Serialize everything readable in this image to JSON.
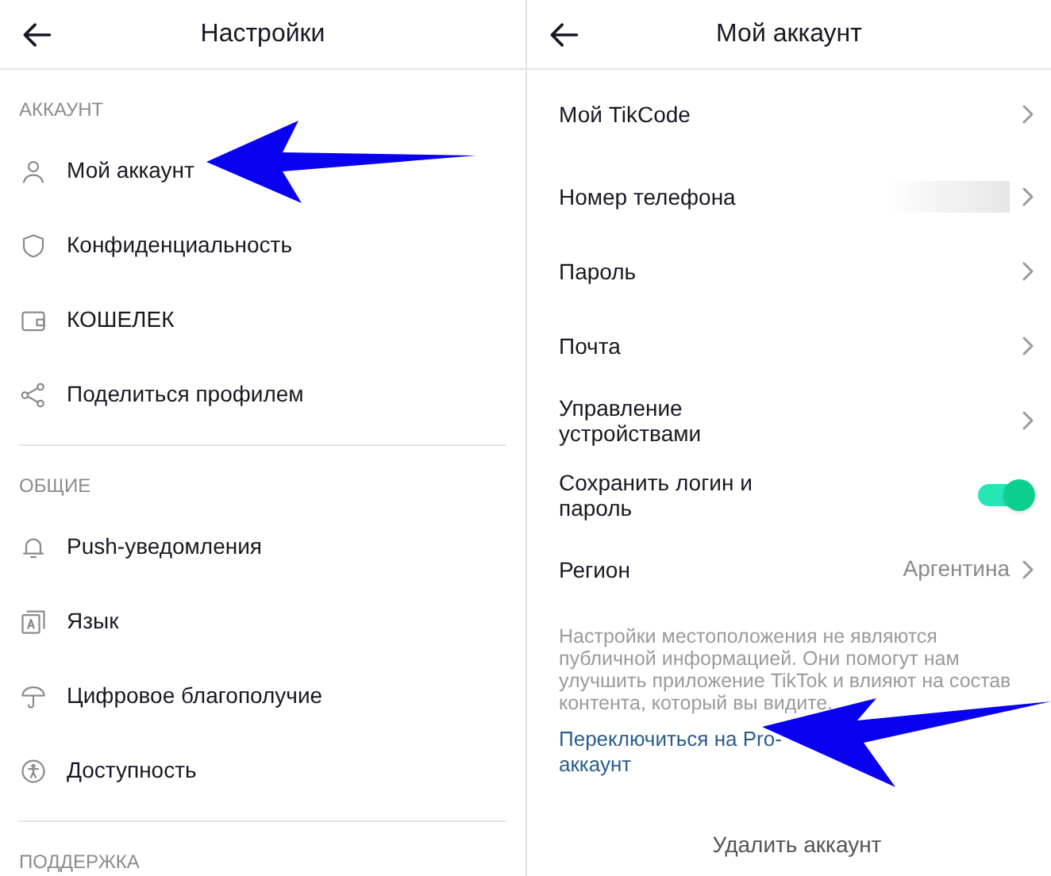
{
  "settings": {
    "title": "Настройки",
    "sections": [
      {
        "heading": "АККАУНТ",
        "items": [
          {
            "label": "Мой аккаунт"
          },
          {
            "label": "Конфиденциальность"
          },
          {
            "label": "КОШЕЛЕК"
          },
          {
            "label": "Поделиться профилем"
          }
        ]
      },
      {
        "heading": "ОБЩИЕ",
        "items": [
          {
            "label": "Push-уведомления"
          },
          {
            "label": "Язык"
          },
          {
            "label": "Цифровое благополучие"
          },
          {
            "label": "Доступность"
          }
        ]
      },
      {
        "heading": "ПОДДЕРЖКА"
      }
    ]
  },
  "account": {
    "title": "Мой аккаунт",
    "rows": [
      {
        "kind": "nav",
        "label": "Мой TikCode"
      },
      {
        "kind": "hidden_value",
        "label": "Номер телефона"
      },
      {
        "kind": "nav",
        "label": "Пароль"
      },
      {
        "kind": "nav",
        "label": "Почта"
      },
      {
        "kind": "nav",
        "label": "Управление устройствами"
      },
      {
        "kind": "toggle",
        "label": "Сохранить логин и пароль",
        "on": true
      },
      {
        "kind": "nav",
        "label": "Регион",
        "value": "Аргентина"
      }
    ],
    "note": "Настройки местоположения не являются публичной информацией. Они помогут нам улучшить приложение TikTok и влияют на состав контента, который вы видите.",
    "pro_link": "Переключиться на Pro-аккаунт",
    "delete_button": "Удалить аккаунт"
  }
}
